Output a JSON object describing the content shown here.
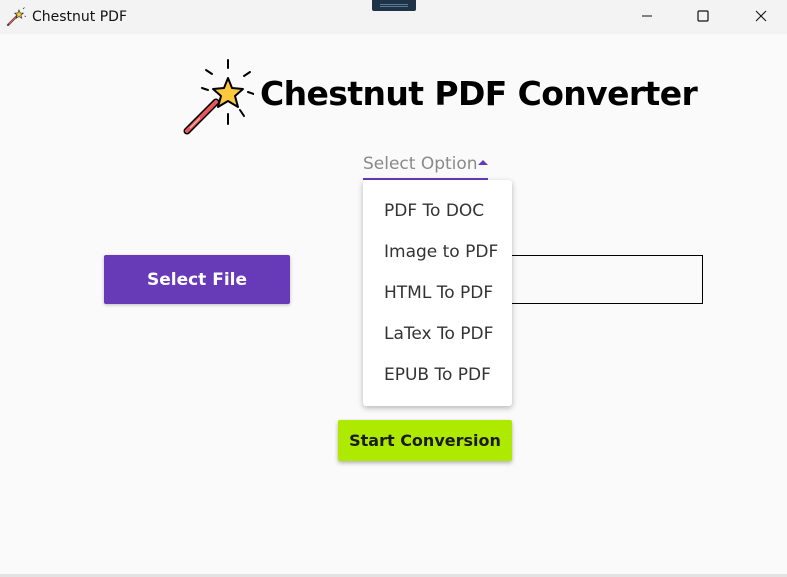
{
  "window": {
    "title": "Chestnut PDF",
    "controls": [
      "minimize-icon",
      "maximize-icon",
      "close-icon"
    ]
  },
  "header": {
    "title": "Chestnut PDF Converter",
    "icon": "magic-wand-icon"
  },
  "conversion_select": {
    "placeholder": "Select Option",
    "underline_color": "#673ab7",
    "options": [
      "PDF To DOC",
      "Image to PDF",
      "HTML To PDF",
      "LaTex To PDF",
      "EPUB To PDF"
    ]
  },
  "file_picker": {
    "button_label": "Select File",
    "button_color": "#673ab7",
    "path_value": ""
  },
  "start_button": {
    "label": "Start Conversion",
    "color": "#aeea00"
  }
}
